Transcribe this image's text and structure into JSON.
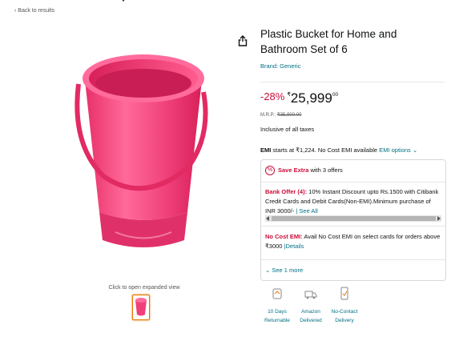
{
  "nav": {
    "back_label": "‹ Back to results"
  },
  "product": {
    "title": "Plastic Bucket for Home and Bathroom Set of 6",
    "brand": "Brand: Generic",
    "image_color": "#f0407a"
  },
  "gallery": {
    "expand_label": "Click to open expanded view"
  },
  "price": {
    "discount": "-28%",
    "currency": "₹",
    "whole": "25,999",
    "fraction": "00",
    "mrp_label": "M.R.P.: ",
    "mrp_value": "₹35,900.00",
    "tax_note": "Inclusive of all taxes"
  },
  "emi": {
    "prefix": "EMI",
    "text": " starts at ₹1,224. No Cost EMI available ",
    "link": "EMI options",
    "chevron": "⌄"
  },
  "offers": {
    "icon": "%",
    "heading_bold": "Save Extra",
    "heading_rest": " with 3 offers",
    "bank_title": "Bank Offer (4):",
    "bank_text": " 10% Instant Discount upto Rs.1500 with Citibank Credit Cards and Debit Cards(Non-EMI).Minimum purchase of INR 3000/- ",
    "bank_link": "| See All",
    "nocost_title": "No Cost EMI:",
    "nocost_text": " Avail No Cost EMI on select cards for orders above ₹3000 ",
    "nocost_link": "|Details",
    "see_more": "⌄ See 1 more"
  },
  "services": [
    {
      "line1": "10 Days",
      "line2": "Returnable",
      "icon": "return-box-icon"
    },
    {
      "line1": "Amazon",
      "line2": "Delivered",
      "icon": "delivery-truck-icon"
    },
    {
      "line1": "No-Contact",
      "line2": "Delivery",
      "icon": "contactless-delivery-icon"
    }
  ],
  "colors": {
    "accent_red": "#cc0c39",
    "link": "#007185",
    "thumb_border": "#e77600"
  }
}
